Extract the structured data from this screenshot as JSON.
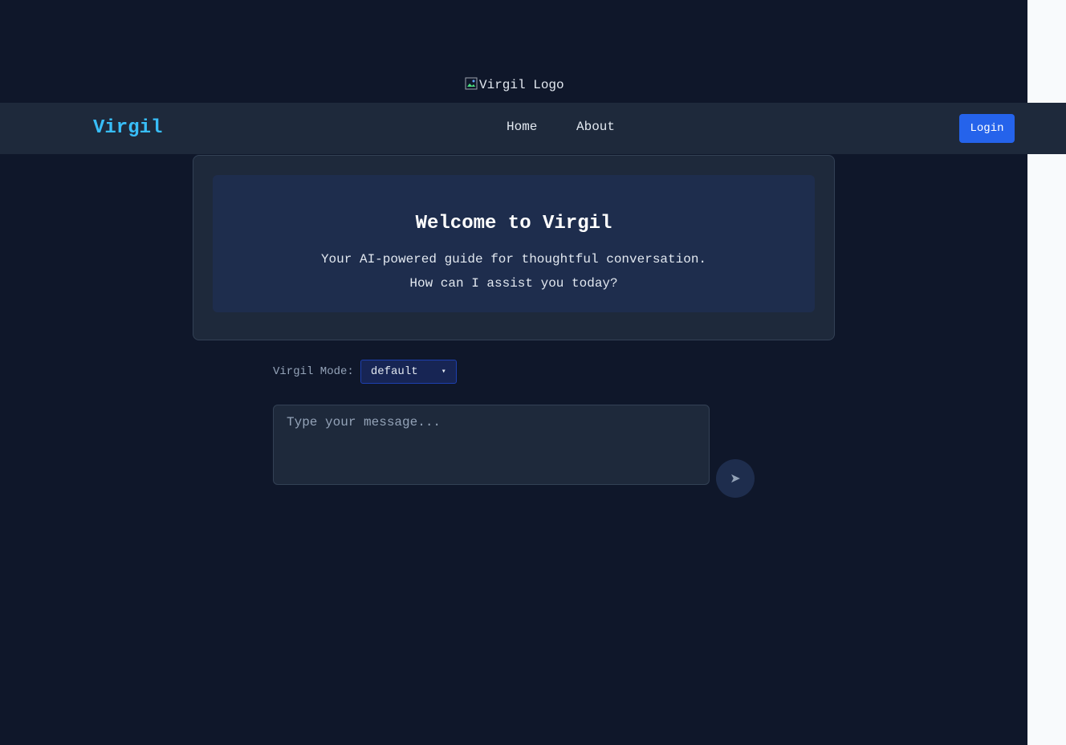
{
  "logo": {
    "alt": "Virgil Logo",
    "icon": "broken-image-icon"
  },
  "navbar": {
    "brand": "Virgil",
    "links": [
      {
        "label": "Home"
      },
      {
        "label": "About"
      }
    ],
    "login_label": "Login"
  },
  "welcome": {
    "title": "Welcome to Virgil",
    "subtitle_line1": "Your AI-powered guide for thoughtful conversation.",
    "subtitle_line2": "How can I assist you today?"
  },
  "mode": {
    "label": "Virgil Mode:",
    "selected": "default",
    "chevron": "▾"
  },
  "message": {
    "value": "",
    "placeholder": "Type your message..."
  },
  "send": {
    "icon": "send-icon",
    "glyph": "➤"
  },
  "colors": {
    "background": "#0f172a",
    "navbar": "#1e293b",
    "brand": "#38bdf8",
    "primary": "#2563eb"
  }
}
